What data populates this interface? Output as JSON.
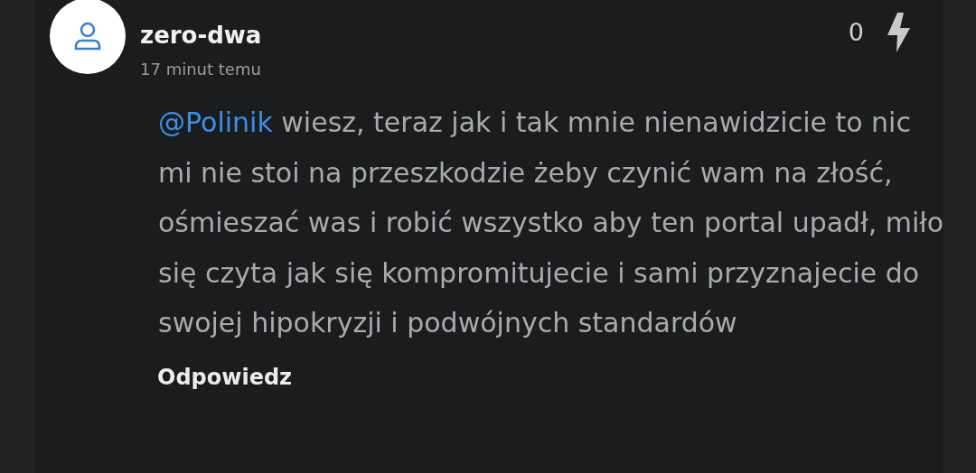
{
  "comment": {
    "author": "zero-dwa",
    "time": "17 minut temu",
    "score": "0",
    "mention": "@Polinik",
    "text": "wiesz, teraz jak i tak mnie nienawidzicie to nic mi nie stoi na przeszkodzie żeby czynić wam na złość, ośmieszać was i robić wszystko aby ten portal upadł, miło się czyta jak się kompromitujecie i sami przyznajecie do swojej hipokryzji i podwójnych standardów",
    "reply": "Odpowiedz"
  }
}
